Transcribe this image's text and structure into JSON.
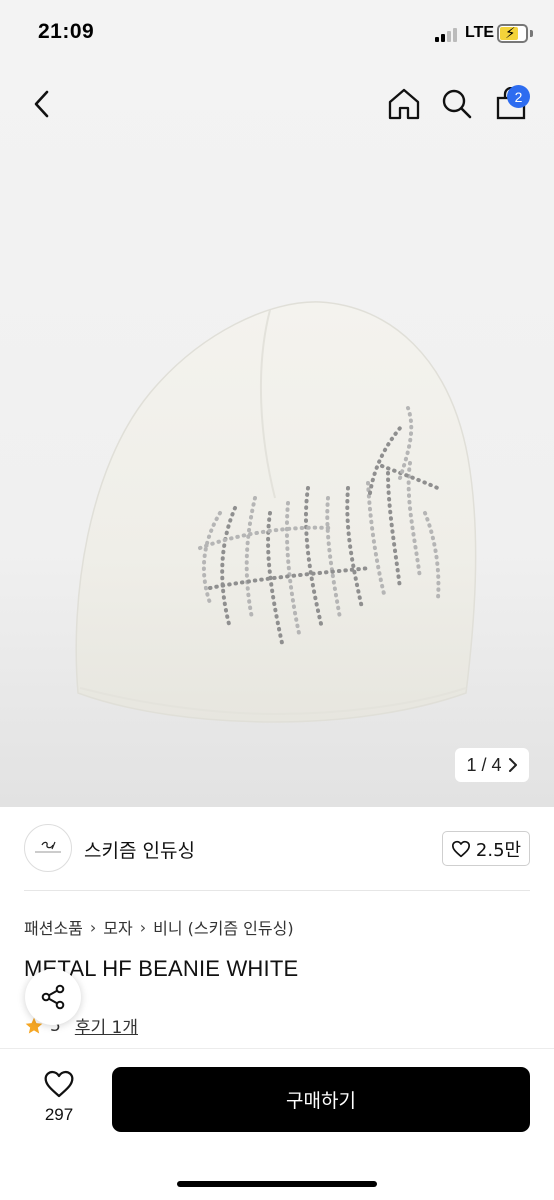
{
  "status_bar": {
    "time": "21:09",
    "network": "LTE",
    "battery_level": 0.7,
    "battery_color": "#f3d33a",
    "charging_icon": "bolt-icon"
  },
  "header": {
    "back_icon": "chevron-left-icon",
    "home_icon": "home-icon",
    "search_icon": "search-icon",
    "cart_icon": "shopping-bag-icon",
    "cart_badge": "2",
    "badge_color": "#2d6cf0"
  },
  "gallery": {
    "counter": "1 / 4",
    "next_icon": "chevron-right-icon"
  },
  "seller": {
    "name": "스키즘 인듀싱",
    "likes": "2.5만",
    "like_icon": "heart-outline-icon"
  },
  "breadcrumb": {
    "items": [
      "패션소품",
      "모자",
      "비니 (스키즘 인듀싱)"
    ]
  },
  "product": {
    "title": "METAL HF BEANIE WHITE",
    "rating": "5",
    "reviews_label": "후기 1개"
  },
  "bottom_bar": {
    "wish_count": "297",
    "buy_label": "구매하기",
    "buy_color": "#000000"
  }
}
